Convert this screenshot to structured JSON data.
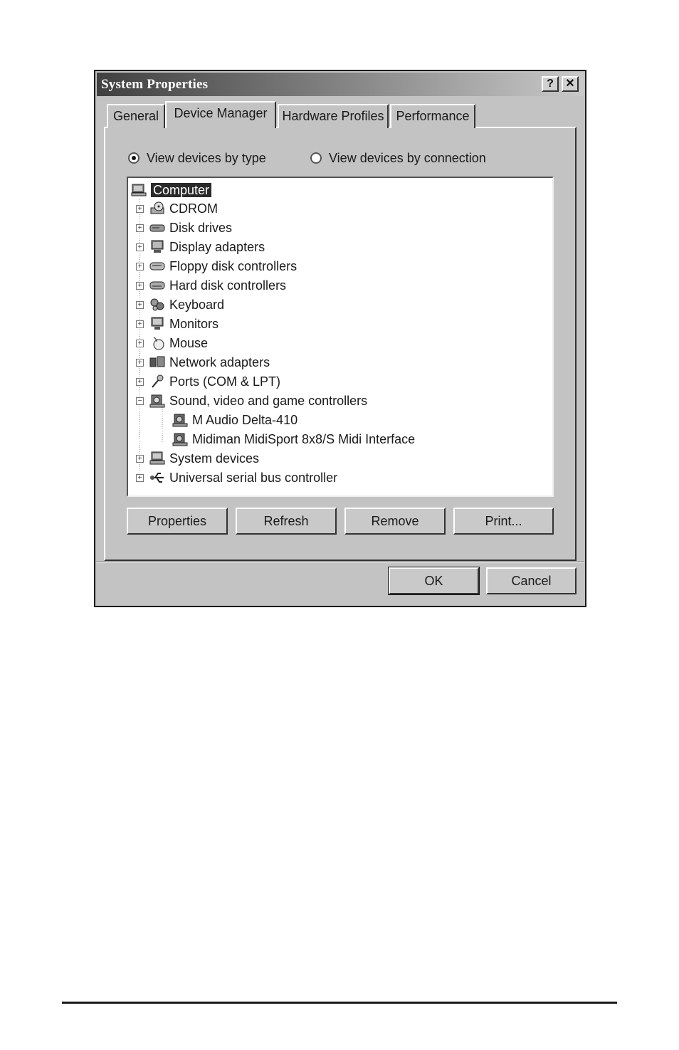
{
  "window": {
    "title": "System Properties",
    "help_label": "?",
    "close_label": "✕"
  },
  "tabs": [
    {
      "label": "General",
      "active": false
    },
    {
      "label": "Device Manager",
      "active": true
    },
    {
      "label": "Hardware Profiles",
      "active": false
    },
    {
      "label": "Performance",
      "active": false
    }
  ],
  "view_options": {
    "by_type": {
      "label": "View devices by type",
      "selected": true
    },
    "by_connection": {
      "label": "View devices by connection",
      "selected": false
    }
  },
  "tree": {
    "root": {
      "label": "Computer",
      "icon": "computer-icon",
      "selected": true
    },
    "items": [
      {
        "label": "CDROM",
        "icon": "cdrom-icon",
        "expander": "+"
      },
      {
        "label": "Disk drives",
        "icon": "disk-drive-icon",
        "expander": "+"
      },
      {
        "label": "Display adapters",
        "icon": "display-adapter-icon",
        "expander": "+"
      },
      {
        "label": "Floppy disk controllers",
        "icon": "floppy-controller-icon",
        "expander": "+"
      },
      {
        "label": "Hard disk controllers",
        "icon": "hard-disk-controller-icon",
        "expander": "+"
      },
      {
        "label": "Keyboard",
        "icon": "keyboard-icon",
        "expander": "+"
      },
      {
        "label": "Monitors",
        "icon": "monitor-icon",
        "expander": "+"
      },
      {
        "label": "Mouse",
        "icon": "mouse-icon",
        "expander": "+"
      },
      {
        "label": "Network adapters",
        "icon": "network-adapter-icon",
        "expander": "+"
      },
      {
        "label": "Ports (COM & LPT)",
        "icon": "port-icon",
        "expander": "+"
      },
      {
        "label": "Sound, video and game controllers",
        "icon": "sound-controller-icon",
        "expander": "−"
      },
      {
        "label": "M Audio Delta-410",
        "icon": "sound-device-icon",
        "child": true
      },
      {
        "label": "Midiman MidiSport 8x8/S Midi Interface",
        "icon": "sound-device-icon",
        "child": true
      },
      {
        "label": "System devices",
        "icon": "system-devices-icon",
        "expander": "+"
      },
      {
        "label": "Universal serial bus controller",
        "icon": "usb-icon",
        "expander": "+"
      }
    ]
  },
  "actions": {
    "properties": "Properties",
    "refresh": "Refresh",
    "remove": "Remove",
    "print": "Print..."
  },
  "footer": {
    "ok": "OK",
    "cancel": "Cancel"
  }
}
